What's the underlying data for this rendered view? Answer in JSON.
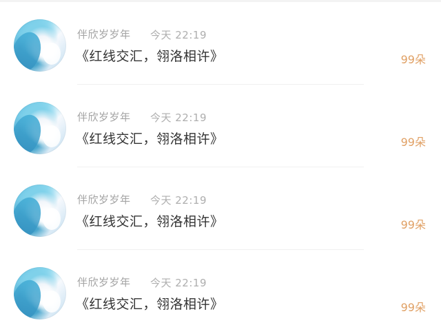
{
  "comments": [
    {
      "author": "伴欣岁岁年",
      "time": "今天 22:19",
      "text": "《红线交汇，翎洛相许》",
      "count": "99朵",
      "avatar": "anime-girl-blue-hair"
    },
    {
      "author": "伴欣岁岁年",
      "time": "今天 22:19",
      "text": "《红线交汇，翎洛相许》",
      "count": "99朵",
      "avatar": "anime-girl-blue-hair"
    },
    {
      "author": "伴欣岁岁年",
      "time": "今天 22:19",
      "text": "《红线交汇，翎洛相许》",
      "count": "99朵",
      "avatar": "anime-girl-blue-hair"
    },
    {
      "author": "伴欣岁岁年",
      "time": "今天 22:19",
      "text": "《红线交汇，翎洛相许》",
      "count": "99朵",
      "avatar": "anime-girl-blue-hair"
    }
  ],
  "colors": {
    "name": "#a3a3a3",
    "time": "#aeaeae",
    "message": "#333333",
    "count": "#e0a064"
  }
}
